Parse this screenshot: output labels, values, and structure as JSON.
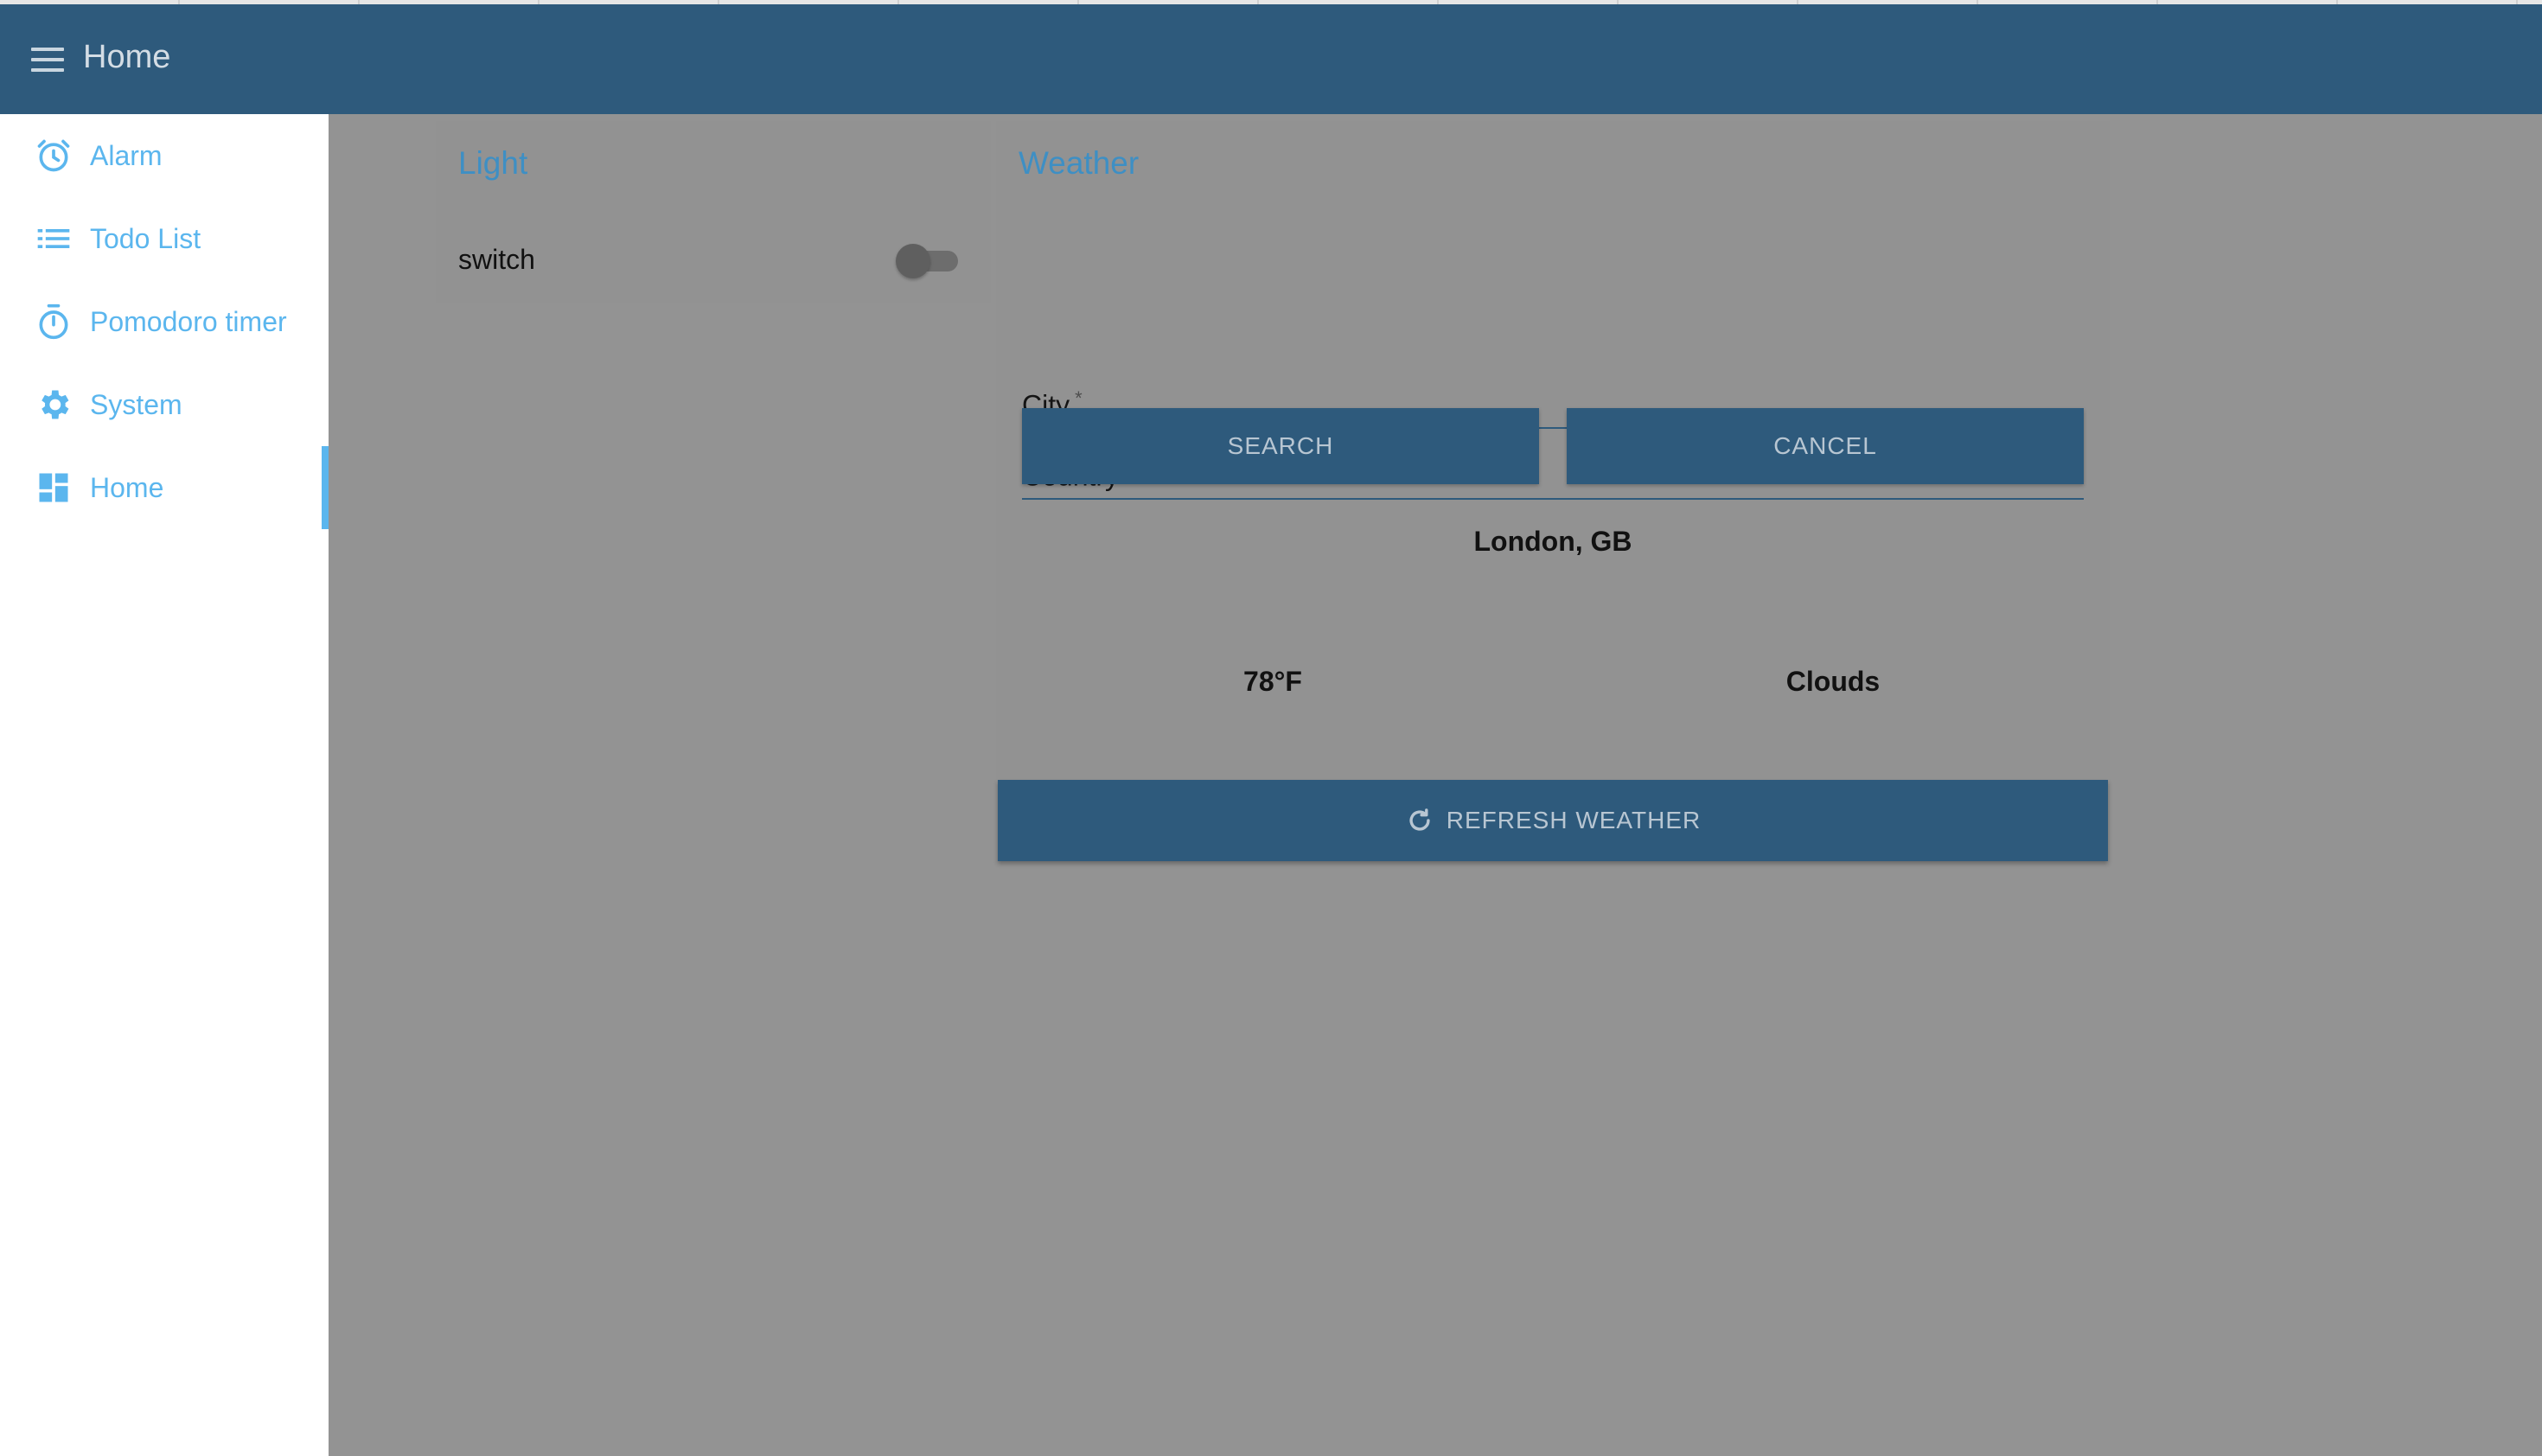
{
  "appbar": {
    "title": "Home"
  },
  "sidebar": {
    "items": [
      {
        "label": "Alarm",
        "icon": "alarm-clock-icon"
      },
      {
        "label": "Todo List",
        "icon": "list-icon"
      },
      {
        "label": "Pomodoro timer",
        "icon": "timer-icon"
      },
      {
        "label": "System",
        "icon": "gear-icon"
      },
      {
        "label": "Home",
        "icon": "dashboard-icon",
        "active": true
      }
    ]
  },
  "light_card": {
    "title": "Light",
    "switch_label": "switch",
    "switch_on": false
  },
  "weather_card": {
    "title": "Weather",
    "city_label": "City",
    "country_label": "Country",
    "required_mark": "*",
    "search_label": "SEARCH",
    "cancel_label": "CANCEL",
    "location": "London, GB",
    "temperature": "78°F",
    "condition": "Clouds",
    "refresh_label": "REFRESH WEATHER"
  },
  "colors": {
    "appbar": "#2e5a7c",
    "accent": "#5bb6ee",
    "card_title": "#3e8fc4",
    "backdrop": "#939393"
  }
}
